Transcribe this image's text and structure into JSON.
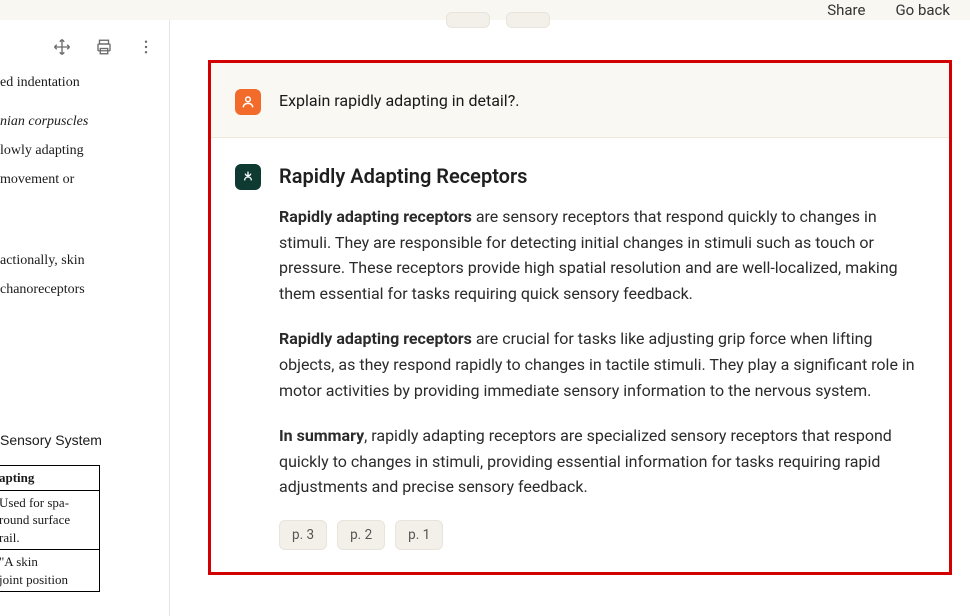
{
  "header": {
    "share": "Share",
    "go_back": "Go back"
  },
  "doc": {
    "line1": "ed indentation",
    "line2": "nian corpuscles",
    "line3": "lowly adapting",
    "line4": " movement or",
    "line5": "actionally, skin",
    "line6": "chanoreceptors",
    "section_title": "Sensory System",
    "table_header": "apting",
    "table_cell1": " Used for spa-\nround surface\nrail.",
    "table_cell2": "   \"A skin\njoint position"
  },
  "ghost_pills": [
    "",
    ""
  ],
  "user_message": "Explain rapidly adapting in detail?.",
  "bot": {
    "title": "Rapidly Adapting Receptors",
    "para1_bold": "Rapidly adapting receptors",
    "para1_rest": " are sensory receptors that respond quickly to changes in stimuli. They are responsible for detecting initial changes in stimuli such as touch or pressure. These receptors provide high spatial resolution and are well-localized, making them essential for tasks requiring quick sensory feedback.",
    "para2_bold": "Rapidly adapting receptors",
    "para2_rest": " are crucial for tasks like adjusting grip force when lifting objects, as they respond rapidly to changes in tactile stimuli. They play a significant role in motor activities by providing immediate sensory information to the nervous system.",
    "para3_bold": "In summary",
    "para3_rest": ", rapidly adapting receptors are specialized sensory receptors that respond quickly to changes in stimuli, providing essential information for tasks requiring rapid adjustments and precise sensory feedback.",
    "pages": [
      "p. 3",
      "p. 2",
      "p. 1"
    ]
  }
}
